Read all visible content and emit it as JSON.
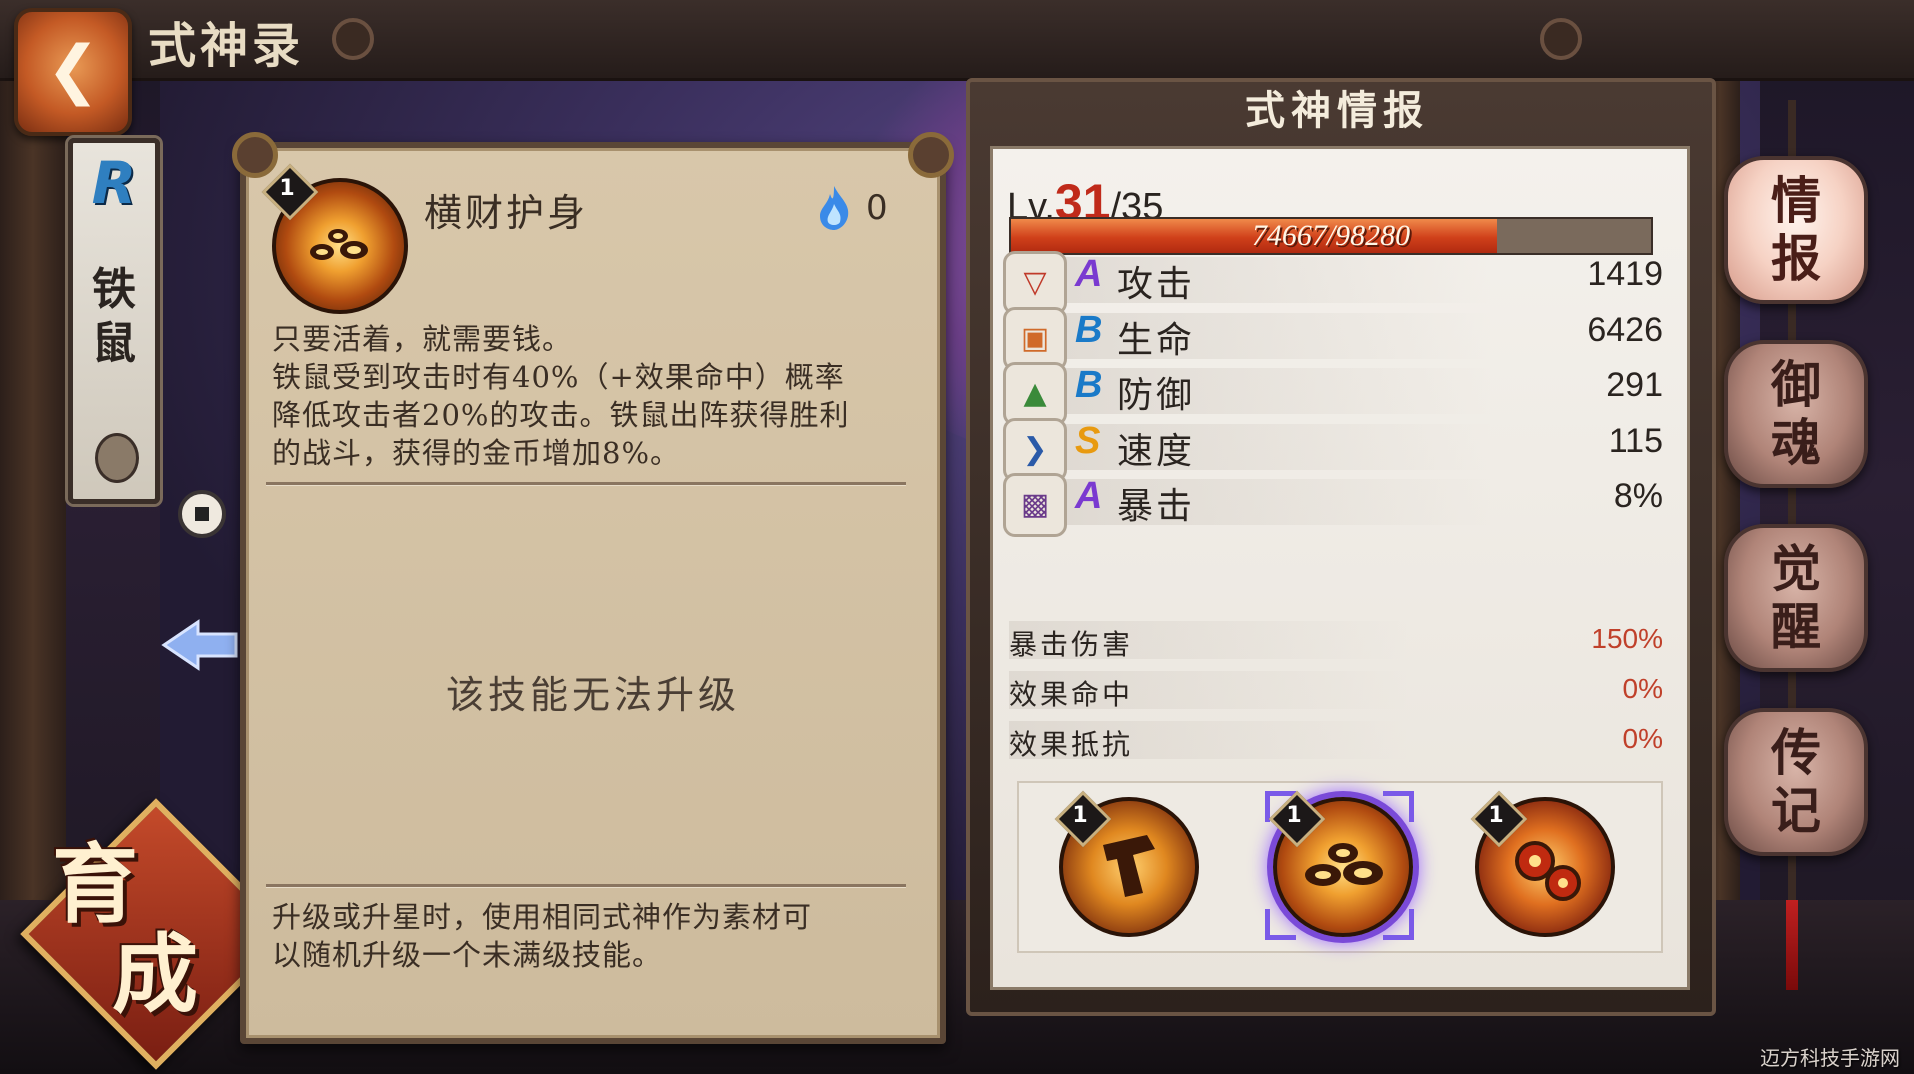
{
  "header": {
    "title": "式神录",
    "back_icon": "back-arrow-icon"
  },
  "character": {
    "rarity": "R",
    "name_line1": "铁",
    "name_line2": "鼠"
  },
  "nurture_badge": {
    "line1": "育",
    "line2": "成"
  },
  "skill_detail": {
    "level": "1",
    "name": "横财护身",
    "fire_cost": "0",
    "description": [
      "只要活着，就需要钱。",
      "铁鼠受到攻击时有40%（+效果命中）概率",
      "降低攻击者20%的攻击。铁鼠出阵获得胜利",
      "的战斗，获得的金币增加8%。"
    ],
    "no_upgrade": "该技能无法升级",
    "footer": [
      "升级或升星时，使用相同式神作为素材可",
      "以随机升级一个未满级技能。"
    ]
  },
  "info": {
    "title": "式神情报",
    "lv_prefix": "Lv.",
    "level": "31",
    "max_level": "/35",
    "exp_current": 74667,
    "exp_max": 98280,
    "exp_text": "74667/98280",
    "stats": [
      {
        "icon": "fan-icon",
        "grade": "A",
        "grade_color": "#7a3ad0",
        "label": "攻击",
        "value": "1419"
      },
      {
        "icon": "scroll-icon",
        "grade": "B",
        "grade_color": "#1a7ac8",
        "label": "生命",
        "value": "6426"
      },
      {
        "icon": "armor-icon",
        "grade": "B",
        "grade_color": "#1a7ac8",
        "label": "防御",
        "value": "291"
      },
      {
        "icon": "speed-icon",
        "grade": "S",
        "grade_color": "#e89a10",
        "label": "速度",
        "value": "115"
      },
      {
        "icon": "talisman-icon",
        "grade": "A",
        "grade_color": "#7a3ad0",
        "label": "暴击",
        "value": "8%"
      }
    ],
    "sub_stats": [
      {
        "label": "暴击伤害",
        "value": "150%"
      },
      {
        "label": "效果命中",
        "value": "0%"
      },
      {
        "label": "效果抵抗",
        "value": "0%"
      }
    ],
    "skills": [
      {
        "level": "1",
        "icon": "hammer-strike-skill-icon"
      },
      {
        "level": "1",
        "icon": "coins-skill-icon",
        "selected": true
      },
      {
        "level": "1",
        "icon": "rolling-coins-skill-icon"
      }
    ]
  },
  "tabs": [
    {
      "line1": "情",
      "line2": "报",
      "active": true
    },
    {
      "line1": "御",
      "line2": "魂"
    },
    {
      "line1": "觉",
      "line2": "醒"
    },
    {
      "line1": "传",
      "line2": "记"
    }
  ],
  "watermark": "迈方科技手游网"
}
